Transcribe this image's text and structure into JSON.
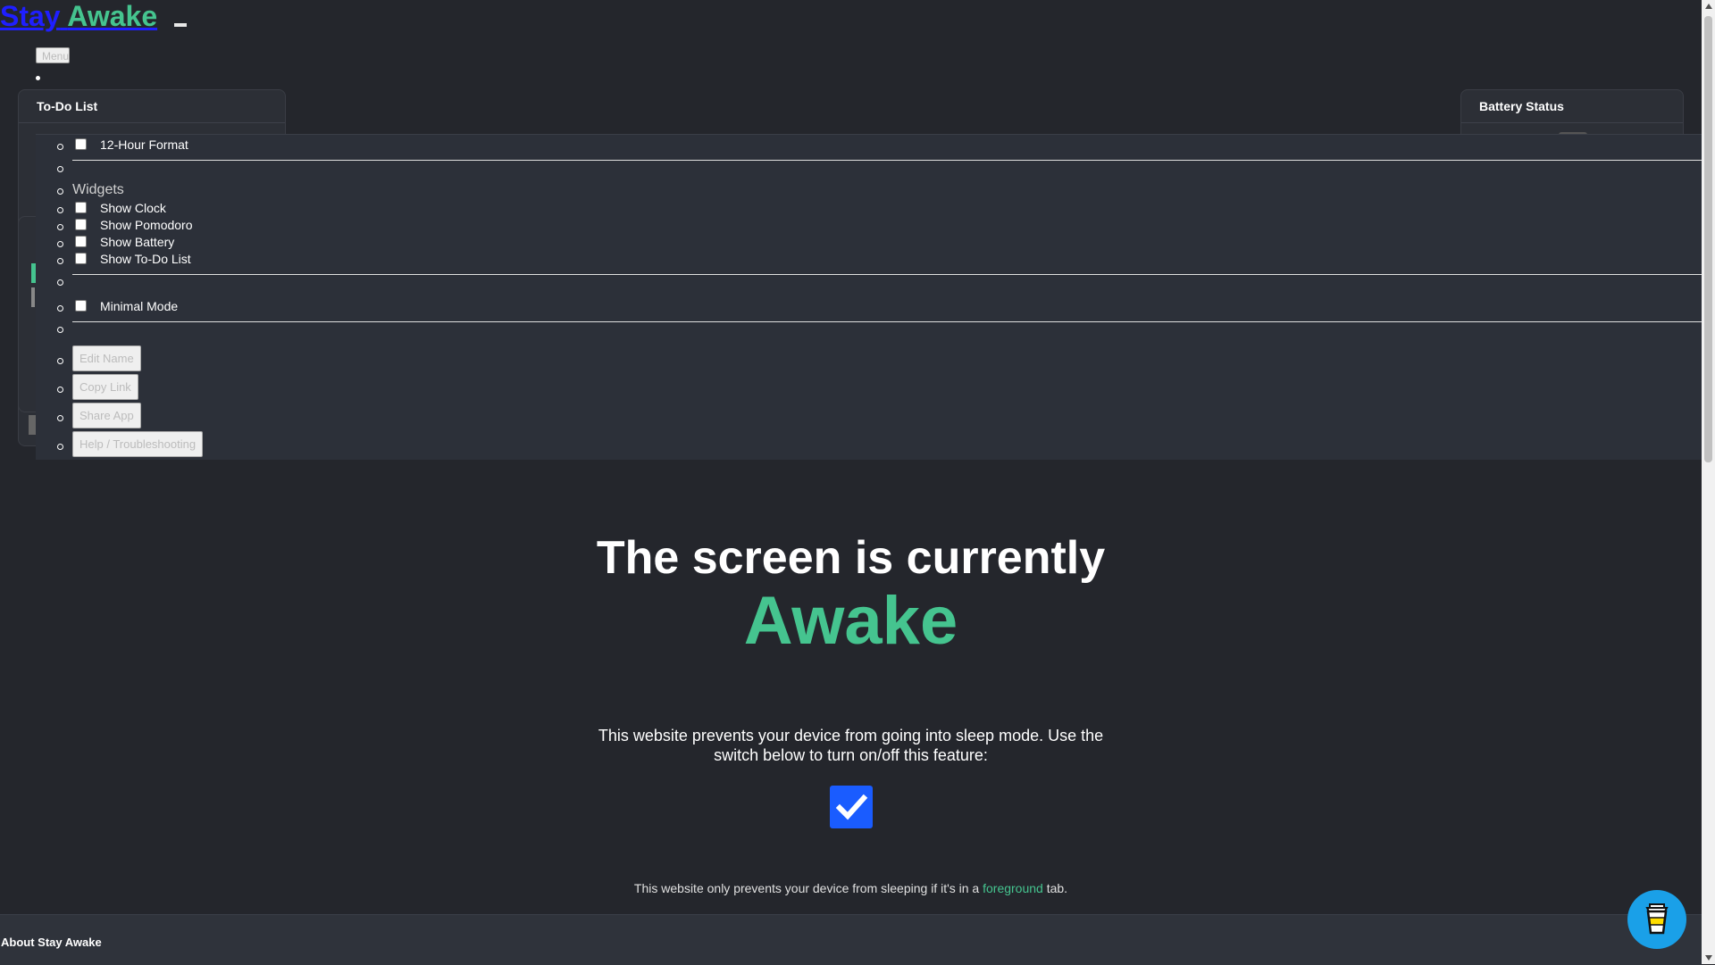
{
  "brand": {
    "word1": "Stay",
    "word2": "Awake"
  },
  "nav": {
    "menu_label": "Menu"
  },
  "widgets_bg": {
    "todo_title": "To-Do List",
    "battery_title": "Battery Status"
  },
  "menu": {
    "time_format_label": "12-Hour Format",
    "widgets_heading": "Widgets",
    "show_clock": "Show Clock",
    "show_pomodoro": "Show Pomodoro",
    "show_battery": "Show Battery",
    "show_todo": "Show To-Do List",
    "minimal_mode": "Minimal Mode",
    "edit_name": "Edit Name",
    "copy_link": "Copy Link",
    "share_app": "Share App",
    "help": "Help / Troubleshooting"
  },
  "hero": {
    "line1": "The screen is currently",
    "status": "Awake",
    "description": "This website prevents your device from going into sleep mode. Use the switch below to turn on/off this feature:",
    "note_before": "This website only prevents your device from sleeping if it's in a ",
    "note_highlight": "foreground",
    "note_after": " tab."
  },
  "about": {
    "title": "About Stay Awake"
  },
  "colors": {
    "background": "#24262c",
    "accent_green": "#45c48f",
    "switch_blue": "#1a5cff",
    "coffee_blue": "#1aa0e8"
  },
  "icons": {
    "menu_toggle": "hamburger-icon",
    "switch": "checkmark-icon",
    "coffee": "coffee-cup-icon"
  }
}
